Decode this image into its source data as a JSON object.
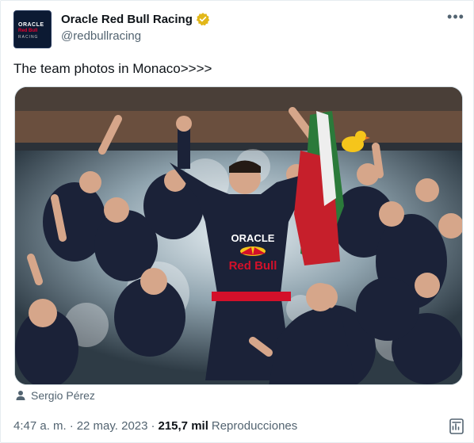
{
  "author": {
    "display_name": "Oracle Red Bull Racing",
    "handle": "@redbullracing",
    "avatar_lines": [
      "ORACLE",
      "Red Bull",
      "RACING"
    ],
    "verified_icon": "gold-verified-badge",
    "verified_color": "#e2b719"
  },
  "menu": {
    "more_label": "•••",
    "icon": "more-horizontal-icon"
  },
  "tweet": {
    "text": "The team photos in Monaco>>>>"
  },
  "photo": {
    "jersey_lines": [
      "ORACLE",
      "Red Bull"
    ],
    "kit_colors": {
      "navy": "#1b2238",
      "red": "#d3102a",
      "yellow": "#f6c41b"
    }
  },
  "tag": {
    "icon": "person-icon",
    "name": "Sergio Pérez"
  },
  "meta": {
    "time": "4:47 a. m.",
    "separator": "·",
    "date": "22 may. 2023",
    "views_count": "215,7 mil",
    "views_label": "Reproducciones",
    "analytics_icon": "analytics-icon"
  }
}
